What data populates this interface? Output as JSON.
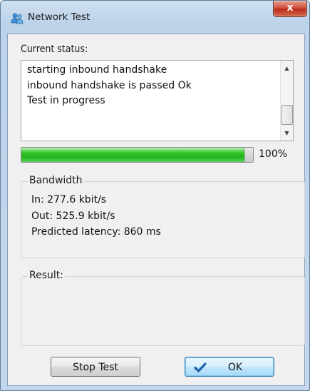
{
  "window": {
    "title": "Network Test",
    "close_label": "x"
  },
  "status": {
    "label": "Current status:",
    "lines": [
      "starting inbound handshake",
      "inbound handshake is passed Ok",
      "Test in progress"
    ]
  },
  "progress": {
    "value": 0.98,
    "percent_label": "100%"
  },
  "bandwidth": {
    "title": "Bandwidth",
    "in": "In: 277.6 kbit/s",
    "out": "Out: 525.9 kbit/s",
    "latency": "Predicted latency: 860 ms"
  },
  "result": {
    "title": "Result:"
  },
  "buttons": {
    "stop": "Stop Test",
    "ok": "OK"
  },
  "colors": {
    "progress_fill": "#22b21b",
    "close": "#c8412c",
    "ok_border": "#3c7fb1"
  }
}
